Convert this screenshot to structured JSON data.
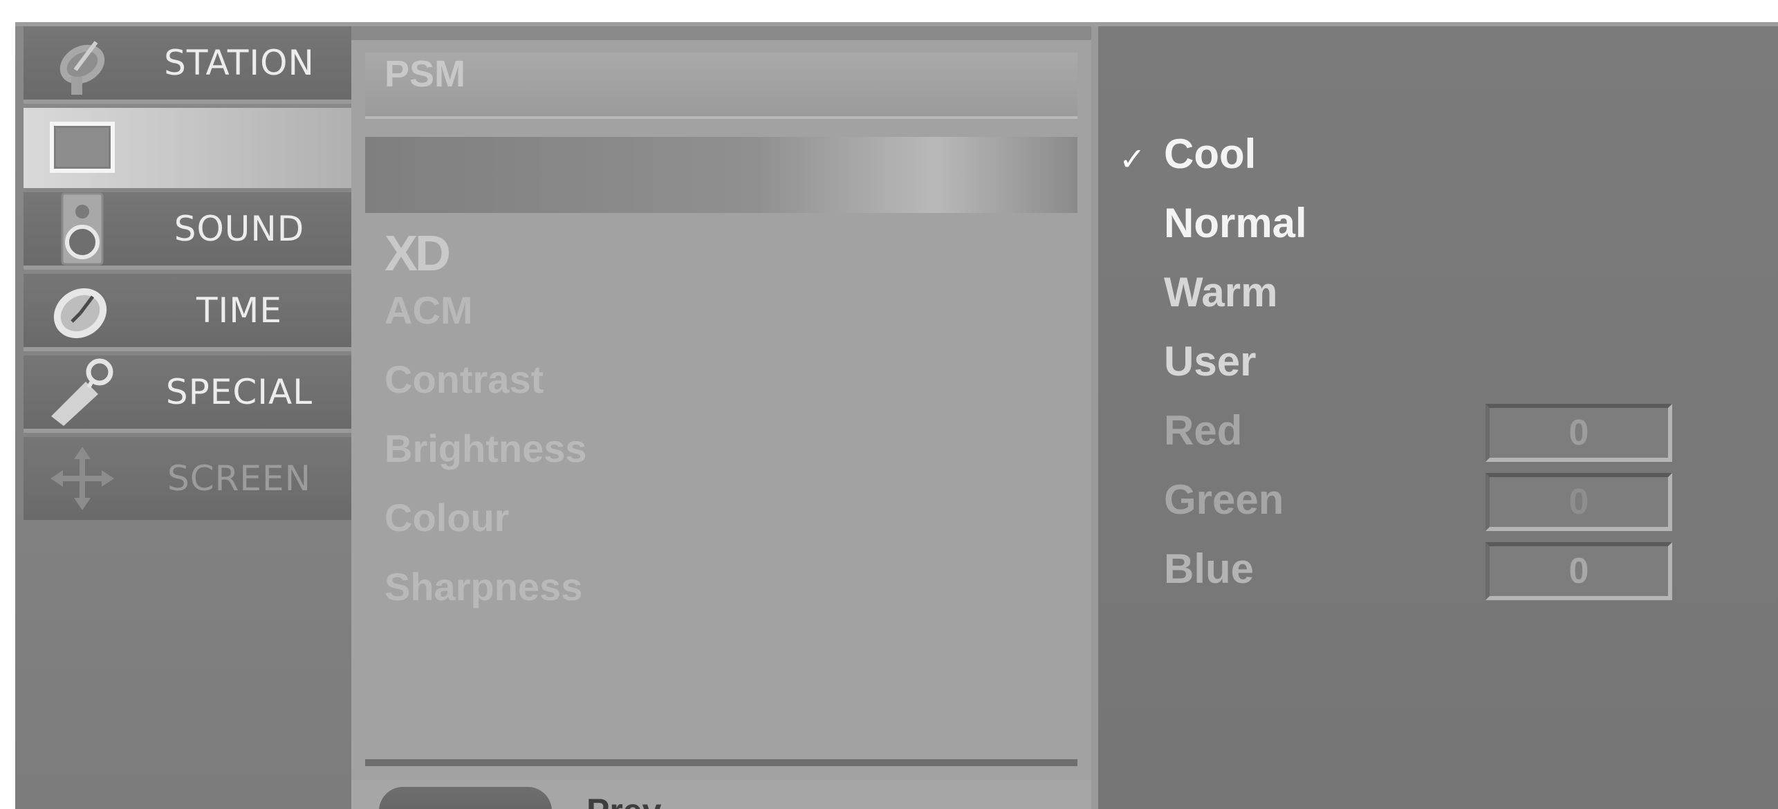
{
  "menu": {
    "categories": [
      {
        "label": "STATION",
        "icon": "satellite-dish-icon"
      },
      {
        "label": "",
        "icon": "picture-screen-icon"
      },
      {
        "label": "SOUND",
        "icon": "speaker-icon"
      },
      {
        "label": "TIME",
        "icon": "clock-icon"
      },
      {
        "label": "SPECIAL",
        "icon": "key-tag-icon"
      },
      {
        "label": "SCREEN",
        "icon": "move-arrows-icon"
      }
    ]
  },
  "picture_menu": {
    "header": "PSM",
    "xd_logo": "XD",
    "items": [
      "ACM",
      "Contrast",
      "Brightness",
      "Colour",
      "Sharpness"
    ]
  },
  "footer": {
    "prev_label": "Prev."
  },
  "options": {
    "check_mark": "✓",
    "presets": [
      "Cool",
      "Normal",
      "Warm",
      "User"
    ],
    "selected": "Cool",
    "rgb": [
      {
        "label": "Red",
        "value": "0"
      },
      {
        "label": "Green",
        "value": "0"
      },
      {
        "label": "Blue",
        "value": "0"
      }
    ]
  },
  "colors": {
    "panel_bg": "#8a8a8a",
    "active_tab": "#d9d9d9",
    "text_bright": "#f3f3f3",
    "text_dim": "#a6a6a6"
  }
}
